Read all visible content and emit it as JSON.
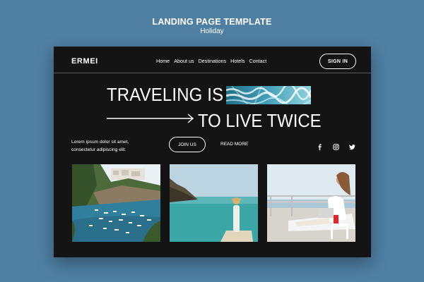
{
  "caption": {
    "title": "LANDING PAGE TEMPLATE",
    "subtitle": "Holiday"
  },
  "nav": {
    "brand": "ERMEI",
    "items": [
      {
        "label": "Home"
      },
      {
        "label": "About us"
      },
      {
        "label": "Destinations"
      },
      {
        "label": "Hotels"
      },
      {
        "label": "Contact"
      }
    ],
    "sign_in": "SIGN IN"
  },
  "hero": {
    "line1": "TRAVELING IS",
    "line2": "TO LIVE TWICE",
    "intro_line1": "Lorem ipsum dolor sit amet,",
    "intro_line2": "consectetur adipiscing elit.",
    "join": "JOIN US",
    "read_more": "READ MORE"
  },
  "socials": [
    "facebook-icon",
    "instagram-icon",
    "twitter-icon"
  ],
  "colors": {
    "page_bg": "#4f7fa2",
    "frame_bg": "#141414",
    "text": "#ffffff"
  }
}
